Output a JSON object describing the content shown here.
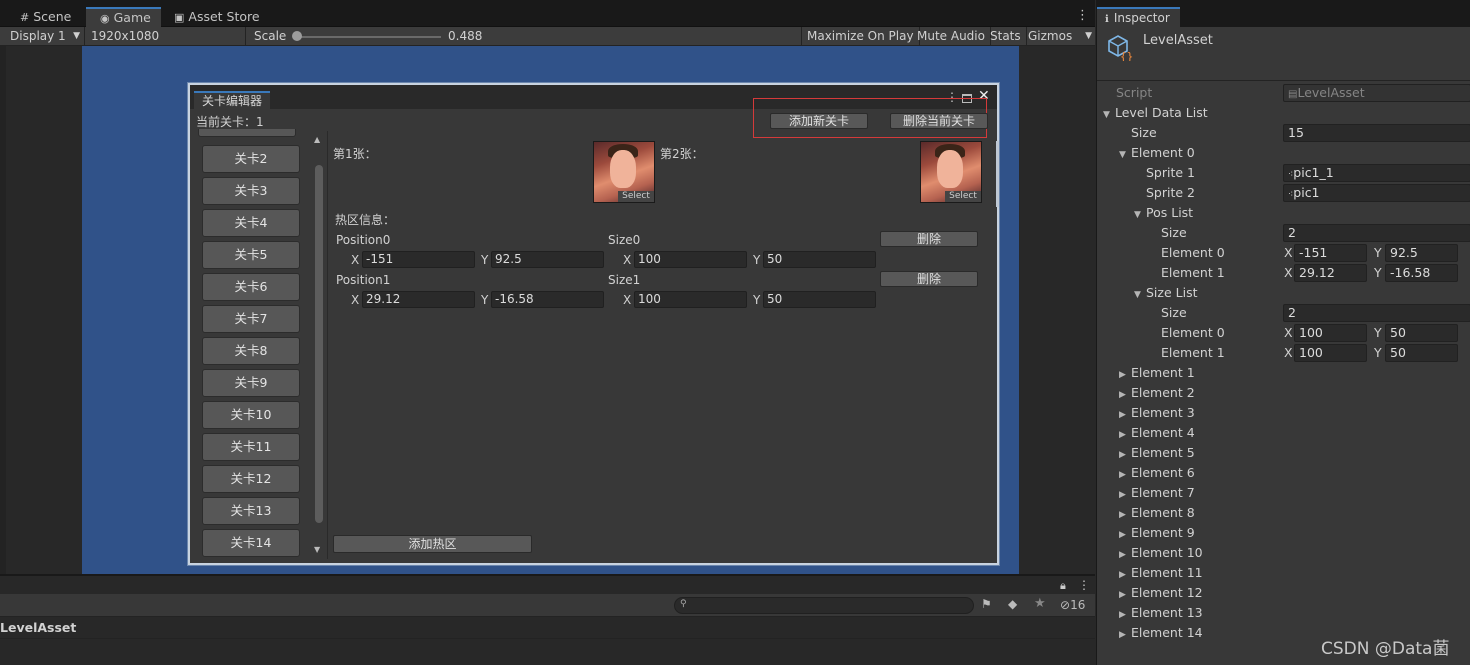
{
  "tabs": {
    "scene": "Scene",
    "game": "Game",
    "asset_store": "Asset Store",
    "inspector": "Inspector"
  },
  "game_toolbar": {
    "display": "Display 1",
    "resolution": "1920x1080 (1920x1080)",
    "scale_label": "Scale",
    "scale_value": "0.488⁩",
    "maximize": "Maximize On Play",
    "mute": "Mute Audio",
    "stats": "Stats",
    "gizmos": "Gizmos",
    "scale_fraction": 0.0
  },
  "editor_window": {
    "tab_title": "关卡编辑器",
    "current_level": "当前关卡：1",
    "add_level": "添加新关卡",
    "delete_level": "删除当前关卡",
    "levels": [
      "关卡2",
      "关卡3",
      "关卡4",
      "关卡5",
      "关卡6",
      "关卡7",
      "关卡8",
      "关卡9",
      "关卡10",
      "关卡11",
      "关卡12",
      "关卡13",
      "关卡14"
    ],
    "pic1_label": "第1张：",
    "pic2_label": "第2张：",
    "select": "Select",
    "hotspot_label": "热区信息：",
    "hotspots": [
      {
        "pos_label": "Position0",
        "size_label": "Size0",
        "px": "-151",
        "py": "92.5",
        "sx": "100",
        "sy": "50",
        "delete": "删除"
      },
      {
        "pos_label": "Position1",
        "size_label": "Size1",
        "px": "29.12",
        "py": "-16.58",
        "sx": "100",
        "sy": "50",
        "delete": "删除"
      }
    ],
    "x": "X",
    "y": "Y",
    "add_hotspot": "添加热区"
  },
  "bottom_panel": {
    "asset_name": "LevelAsset",
    "hidden_count": "16"
  },
  "inspector": {
    "title": "LevelAsset",
    "script_label": "Script",
    "script_value": "LevelAsset",
    "level_data_list": "Level Data List",
    "size_label": "Size",
    "size_value": "15",
    "element0": "Element 0",
    "sprite1_label": "Sprite 1",
    "sprite1_value": "pic1_1",
    "sprite2_label": "Sprite 2",
    "sprite2_value": "pic1",
    "pos_list": "Pos List",
    "pos_size": "2",
    "pos_elements": [
      {
        "label": "Element 0",
        "x": "-151",
        "y": "92.5"
      },
      {
        "label": "Element 1",
        "x": "29.12",
        "y": "-16.58"
      }
    ],
    "size_list": "Size List",
    "size_size": "2",
    "size_elements": [
      {
        "label": "Element 0",
        "x": "100",
        "y": "50"
      },
      {
        "label": "Element 1",
        "x": "100",
        "y": "50"
      }
    ],
    "collapsed_elements": [
      "Element 1",
      "Element 2",
      "Element 3",
      "Element 4",
      "Element 5",
      "Element 6",
      "Element 7",
      "Element 8",
      "Element 9",
      "Element 10",
      "Element 11",
      "Element 12",
      "Element 13",
      "Element 14"
    ],
    "x": "X",
    "y": "Y"
  },
  "watermark": "CSDN @Data菌",
  "colors": {
    "accent_tab": "#3a79bb",
    "canvas": "#305289",
    "highlight_box": "#d43a3a"
  }
}
